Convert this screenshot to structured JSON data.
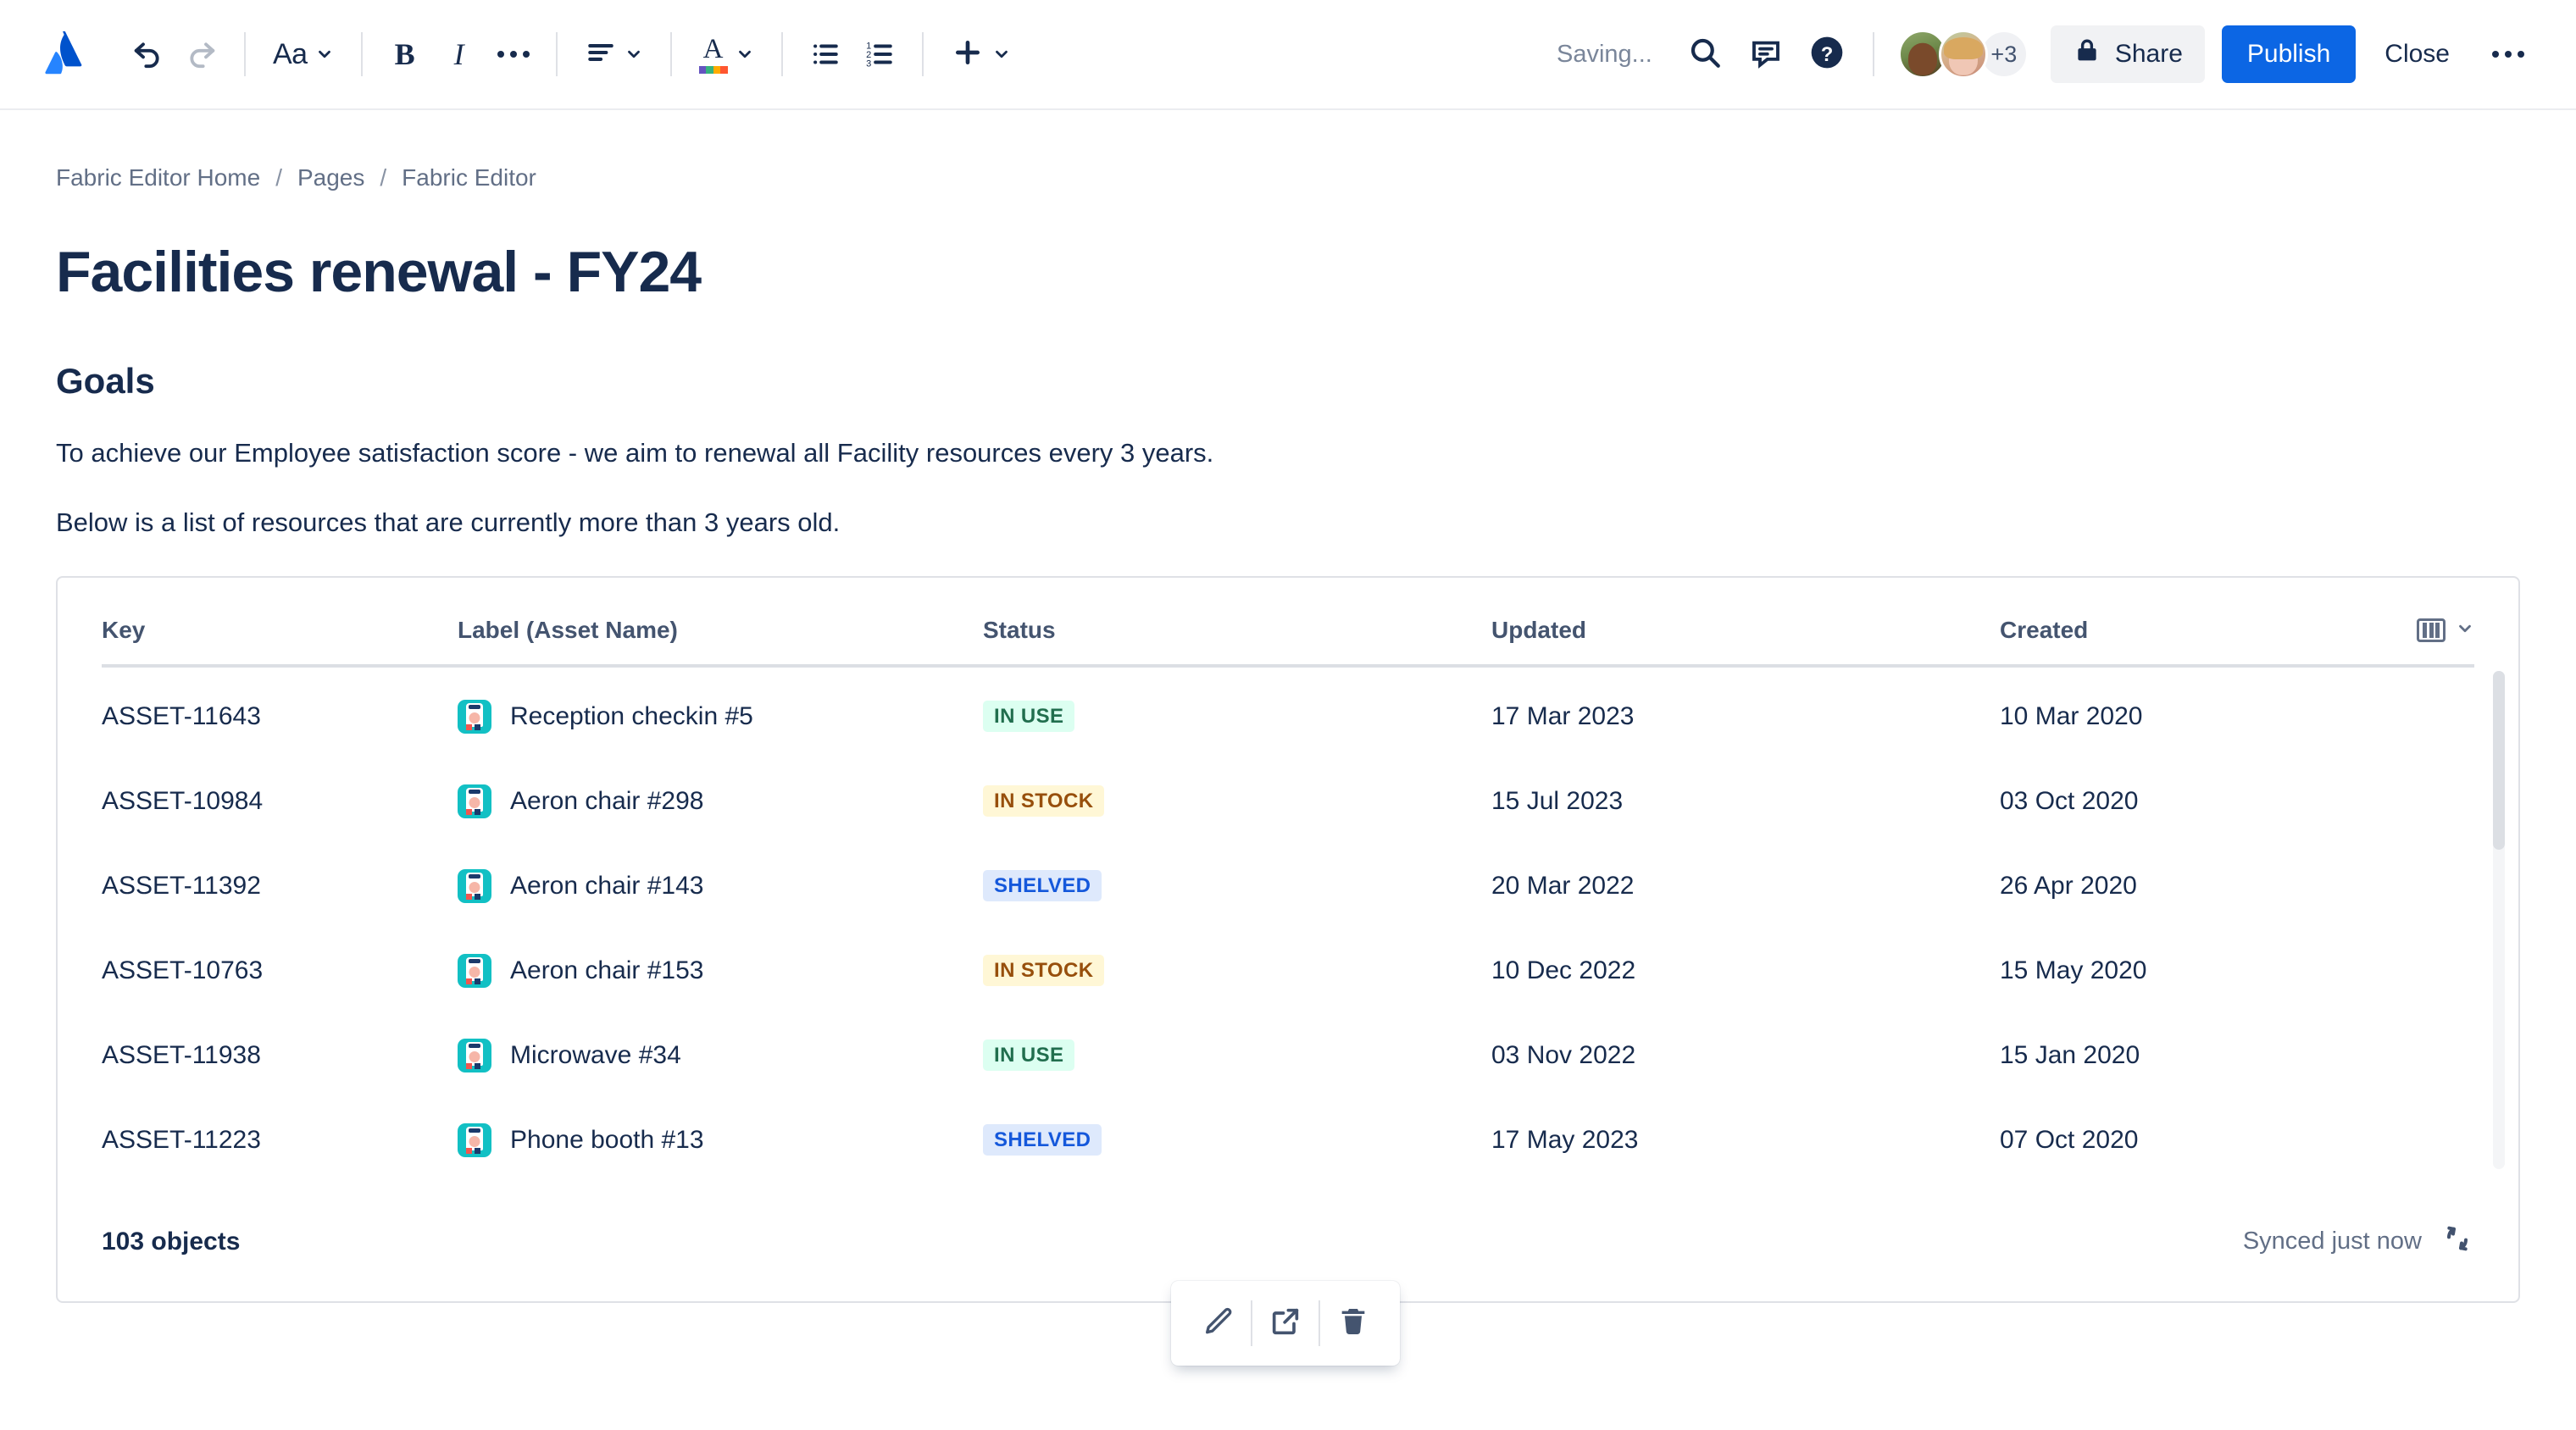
{
  "toolbar": {
    "logo_name": "atlassian-logo",
    "undo_label": "Undo",
    "redo_label": "Redo",
    "text_style_label": "Aa",
    "bold_label": "B",
    "italic_label": "I",
    "more_formatting_label": "More formatting options",
    "alignment_label": "Text alignment",
    "text_color_label": "A",
    "bullet_list_label": "Bullet list",
    "numbered_list_label": "Numbered list",
    "insert_label": "Insert",
    "status_text": "Saving...",
    "search_label": "Search",
    "comment_label": "Comment",
    "help_label": "Help",
    "avatar_overflow": "+3",
    "share_label": "Share",
    "publish_label": "Publish",
    "close_label": "Close",
    "more_label": "More actions",
    "accent_color": "#0C66E4"
  },
  "breadcrumb": {
    "items": [
      {
        "label": "Fabric Editor Home"
      },
      {
        "label": "Pages"
      },
      {
        "label": "Fabric Editor"
      }
    ],
    "separator": "/"
  },
  "document": {
    "title": "Facilities renewal - FY24",
    "heading": "Goals",
    "paragraph_1": "To achieve our Employee satisfaction score - we aim to renewal all Facility resources every 3 years.",
    "paragraph_2": "Below is a list of resources that are currently more than 3 years old."
  },
  "table": {
    "columns": [
      "Key",
      "Label (Asset Name)",
      "Status",
      "Updated",
      "Created"
    ],
    "column_settings_label": "Column settings",
    "rows": [
      {
        "key": "ASSET-11643",
        "label": "Reception checkin #5",
        "status": "IN USE",
        "status_tone": "green",
        "updated": "17 Mar 2023",
        "created": "10 Mar 2020"
      },
      {
        "key": "ASSET-10984",
        "label": "Aeron chair #298",
        "status": "IN STOCK",
        "status_tone": "yellow",
        "updated": "15 Jul 2023",
        "created": "03 Oct 2020"
      },
      {
        "key": "ASSET-11392",
        "label": "Aeron chair #143",
        "status": "SHELVED",
        "status_tone": "blue",
        "updated": "20 Mar 2022",
        "created": "26 Apr 2020"
      },
      {
        "key": "ASSET-10763",
        "label": "Aeron chair #153",
        "status": "IN STOCK",
        "status_tone": "yellow",
        "updated": "10 Dec 2022",
        "created": "15 May 2020"
      },
      {
        "key": "ASSET-11938",
        "label": "Microwave #34",
        "status": "IN USE",
        "status_tone": "green",
        "updated": "03 Nov 2022",
        "created": "15 Jan 2020"
      },
      {
        "key": "ASSET-11223",
        "label": "Phone booth #13",
        "status": "SHELVED",
        "status_tone": "blue",
        "updated": "17 May 2023",
        "created": "07 Oct 2020"
      }
    ],
    "object_count": "103 objects",
    "sync_status": "Synced just now",
    "status_colors": {
      "in_use_bg": "#DCFFF1",
      "in_use_fg": "#216E4E",
      "in_stock_bg": "#FFF7D6",
      "in_stock_fg": "#974F0C",
      "shelved_bg": "#DEE9FC",
      "shelved_fg": "#1558DB"
    }
  },
  "floating_toolbar": {
    "edit_label": "Edit",
    "open_label": "Open in new tab",
    "delete_label": "Remove"
  }
}
